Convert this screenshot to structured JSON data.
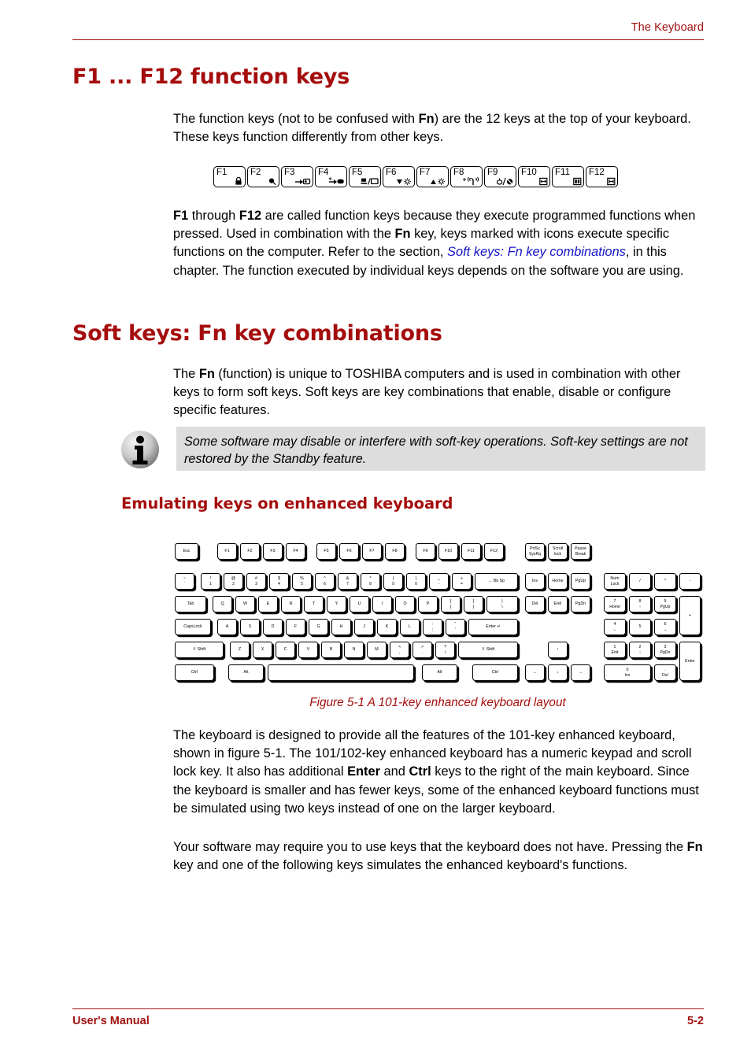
{
  "header": {
    "title": "The Keyboard",
    "rule_color": "#A01010"
  },
  "footer": {
    "left": "User's Manual",
    "right": "5-2"
  },
  "headings": {
    "h1_function_keys": "F1 ... F12 function keys",
    "h1_soft_keys": "Soft keys: Fn key combinations",
    "h2_emulating": "Emulating keys on enhanced keyboard"
  },
  "paragraphs": {
    "intro_p1_a": "The function keys (not to be confused with ",
    "intro_p1_b": "Fn",
    "intro_p1_c": ") are the 12 keys at the top of your keyboard. These keys function differently from other keys.",
    "p2_a": "F1",
    "p2_b": " through ",
    "p2_c": "F12",
    "p2_d": " are called function keys because they execute programmed functions when pressed. Used in combination with the ",
    "p2_e": "Fn",
    "p2_f": " key, keys marked with icons execute specific functions on the computer. Refer to the section, ",
    "p2_link": "Soft keys: Fn key combinations",
    "p2_g": ", in this chapter. The function executed by individual keys depends on the software you are using.",
    "p3_a": "The ",
    "p3_b": "Fn",
    "p3_c": " (function) is unique to TOSHIBA computers and is used in combination with other keys to form soft keys. Soft keys are key combinations that enable, disable or configure specific features.",
    "p4_a": "The keyboard is designed to provide all the features of the 101-key enhanced keyboard, shown in figure 5-1. The 101/102-key enhanced keyboard has a numeric keypad and scroll lock key. It also has additional ",
    "p4_b": "Enter",
    "p4_c": " and ",
    "p4_d": "Ctrl",
    "p4_e": " keys to the right of the main keyboard. Since the keyboard is smaller and has fewer keys, some of the enhanced keyboard functions must be simulated using two keys instead of one on the larger keyboard.",
    "p5_a": "Your software may require you to use keys that the keyboard does not have. Pressing the ",
    "p5_b": "Fn",
    "p5_c": " key and one of the following keys simulates the enhanced keyboard's functions."
  },
  "note": {
    "icon": "info-icon",
    "text": "Some software may disable or interfere with soft-key operations. Soft-key settings are not restored by the Standby feature.",
    "background": "#DDDDDD"
  },
  "fn_key_strip": [
    {
      "label": "F1",
      "icon": "lock-icon"
    },
    {
      "label": "F2",
      "icon": "power-plan-icon"
    },
    {
      "label": "F3",
      "icon": "standby-icon"
    },
    {
      "label": "F4",
      "icon": "hibernate-icon"
    },
    {
      "label": "F5",
      "icon": "display-output-icon"
    },
    {
      "label": "F6",
      "icon": "brightness-down-icon"
    },
    {
      "label": "F7",
      "icon": "brightness-up-icon"
    },
    {
      "label": "F8",
      "icon": "wireless-icon"
    },
    {
      "label": "F9",
      "icon": "touchpad-off-icon"
    },
    {
      "label": "F10",
      "icon": "arrow-mode-icon"
    },
    {
      "label": "F11",
      "icon": "numeric-mode-icon"
    },
    {
      "label": "F12",
      "icon": "scroll-lock-icon"
    }
  ],
  "figure": {
    "caption": "Figure 5-1 A 101-key enhanced keyboard layout",
    "caption_color": "#A50D0D",
    "keyboard": {
      "function_row": [
        {
          "top": "Esc"
        },
        {
          "top": "F1"
        },
        {
          "top": "F2"
        },
        {
          "top": "F3"
        },
        {
          "top": "F4"
        },
        {
          "top": "F5"
        },
        {
          "top": "F6"
        },
        {
          "top": "F7"
        },
        {
          "top": "F8"
        },
        {
          "top": "F9"
        },
        {
          "top": "F10"
        },
        {
          "top": "F11"
        },
        {
          "top": "F12"
        },
        {
          "top": "PrtSc",
          "sub": "SysRq"
        },
        {
          "top": "Scroll",
          "sub": "lock"
        },
        {
          "top": "Pause",
          "sub": "Break"
        }
      ],
      "number_row": [
        {
          "top": "~",
          "sub": "`"
        },
        {
          "top": "!",
          "sub": "1"
        },
        {
          "top": "@",
          "sub": "2"
        },
        {
          "top": "#",
          "sub": "3"
        },
        {
          "top": "$",
          "sub": "4"
        },
        {
          "top": "%",
          "sub": "5"
        },
        {
          "top": "^",
          "sub": "6"
        },
        {
          "top": "&",
          "sub": "7"
        },
        {
          "top": "*",
          "sub": "8"
        },
        {
          "top": "(",
          "sub": "9"
        },
        {
          "top": ")",
          "sub": "0"
        },
        {
          "top": "_",
          "sub": "-"
        },
        {
          "top": "+",
          "sub": "="
        },
        {
          "top": "← Bk Sp"
        }
      ],
      "tab_row": [
        {
          "top": "Tab"
        },
        {
          "top": "Q"
        },
        {
          "top": "W"
        },
        {
          "top": "E"
        },
        {
          "top": "R"
        },
        {
          "top": "T"
        },
        {
          "top": "Y"
        },
        {
          "top": "U"
        },
        {
          "top": "I"
        },
        {
          "top": "O"
        },
        {
          "top": "P"
        },
        {
          "top": "{",
          "sub": "["
        },
        {
          "top": "}",
          "sub": "]"
        },
        {
          "top": "|",
          "sub": "\\"
        }
      ],
      "caps_row": [
        {
          "top": "CapsLock"
        },
        {
          "top": "A"
        },
        {
          "top": "S"
        },
        {
          "top": "D"
        },
        {
          "top": "F"
        },
        {
          "top": "G"
        },
        {
          "top": "H"
        },
        {
          "top": "J"
        },
        {
          "top": "K"
        },
        {
          "top": "L"
        },
        {
          "top": ":",
          "sub": ";"
        },
        {
          "top": "\"",
          "sub": "'"
        },
        {
          "top": "Enter ↵"
        }
      ],
      "shift_row": [
        {
          "top": "⇧ Shift"
        },
        {
          "top": "Z"
        },
        {
          "top": "X"
        },
        {
          "top": "C"
        },
        {
          "top": "V"
        },
        {
          "top": "B"
        },
        {
          "top": "N"
        },
        {
          "top": "M"
        },
        {
          "top": "<",
          "sub": ","
        },
        {
          "top": ">",
          "sub": "."
        },
        {
          "top": "?",
          "sub": "/"
        },
        {
          "top": "⇧ Shift"
        }
      ],
      "ctrl_row": [
        {
          "top": "Ctrl"
        },
        {
          "top": "Alt"
        },
        {
          "top": ""
        },
        {
          "top": "Alt"
        },
        {
          "top": "Ctrl"
        }
      ],
      "nav_cluster": [
        {
          "top": "Ins"
        },
        {
          "top": "Home"
        },
        {
          "top": "PgUp"
        },
        {
          "top": "Del"
        },
        {
          "top": "End"
        },
        {
          "top": "PgDn"
        }
      ],
      "arrow_cluster": [
        {
          "top": "↑"
        },
        {
          "top": "←"
        },
        {
          "top": "↓"
        },
        {
          "top": "→"
        }
      ],
      "numpad": [
        {
          "top": "Num",
          "sub": "Lock"
        },
        {
          "top": "/"
        },
        {
          "top": "*"
        },
        {
          "top": "-"
        },
        {
          "top": "7",
          "sub": "Home"
        },
        {
          "top": "8",
          "sub": "↑"
        },
        {
          "top": "9",
          "sub": "PgUp"
        },
        {
          "top": "+"
        },
        {
          "top": "4",
          "sub": "←"
        },
        {
          "top": "5"
        },
        {
          "top": "6",
          "sub": "→"
        },
        {
          "top": "1",
          "sub": "End"
        },
        {
          "top": "2",
          "sub": "↓"
        },
        {
          "top": "3",
          "sub": "PgDn"
        },
        {
          "top": "Enter"
        },
        {
          "top": "0",
          "sub": "Ins"
        },
        {
          "top": ".",
          "sub": "Del"
        }
      ]
    }
  }
}
